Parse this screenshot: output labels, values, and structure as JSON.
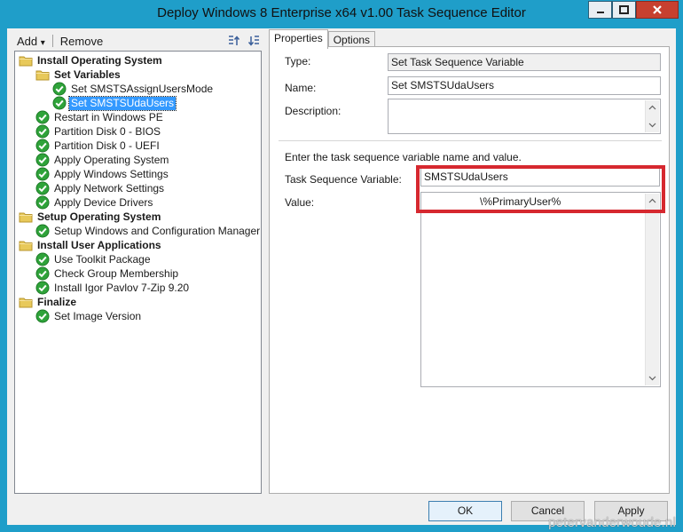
{
  "window": {
    "title": "Deploy Windows 8 Enterprise x64 v1.00 Task Sequence Editor"
  },
  "toolbar": {
    "add_label": "Add",
    "add_arrow": "▾",
    "remove_label": "Remove"
  },
  "tree": {
    "items": [
      {
        "label": "Install Operating System",
        "kind": "group",
        "level": 0
      },
      {
        "label": "Set Variables",
        "kind": "group",
        "level": 1
      },
      {
        "label": "Set SMSTSAssignUsersMode",
        "kind": "step",
        "level": 2
      },
      {
        "label": "Set SMSTSUdaUsers",
        "kind": "step",
        "level": 2,
        "selected": true
      },
      {
        "label": "Restart in Windows PE",
        "kind": "step",
        "level": 1
      },
      {
        "label": "Partition Disk 0 - BIOS",
        "kind": "step",
        "level": 1
      },
      {
        "label": "Partition Disk 0 - UEFI",
        "kind": "step",
        "level": 1
      },
      {
        "label": "Apply Operating System",
        "kind": "step",
        "level": 1
      },
      {
        "label": "Apply Windows Settings",
        "kind": "step",
        "level": 1
      },
      {
        "label": "Apply Network Settings",
        "kind": "step",
        "level": 1
      },
      {
        "label": "Apply Device Drivers",
        "kind": "step",
        "level": 1
      },
      {
        "label": "Setup Operating System",
        "kind": "group",
        "level": 0
      },
      {
        "label": "Setup Windows and Configuration Manager",
        "kind": "step",
        "level": 1
      },
      {
        "label": "Install User Applications",
        "kind": "group",
        "level": 0
      },
      {
        "label": "Use Toolkit Package",
        "kind": "step",
        "level": 1
      },
      {
        "label": "Check Group Membership",
        "kind": "step",
        "level": 1
      },
      {
        "label": "Install Igor Pavlov 7-Zip 9.20",
        "kind": "step",
        "level": 1
      },
      {
        "label": "Finalize",
        "kind": "group",
        "level": 0
      },
      {
        "label": "Set Image Version",
        "kind": "step",
        "level": 1
      }
    ]
  },
  "tabs": {
    "properties": "Properties",
    "options": "Options"
  },
  "properties": {
    "type_label": "Type:",
    "type_value": "Set Task Sequence Variable",
    "name_label": "Name:",
    "name_value": "Set SMSTSUdaUsers",
    "description_label": "Description:",
    "description_value": "",
    "instruction": "Enter the task sequence variable name and value.",
    "variable_label": "Task Sequence Variable:",
    "variable_value": "SMSTSUdaUsers",
    "value_label": "Value:",
    "value_value": "\\%PrimaryUser%"
  },
  "buttons": {
    "ok": "OK",
    "cancel": "Cancel",
    "apply": "Apply"
  },
  "watermark": "petervanderwoude.nl",
  "colors": {
    "frame": "#1f9ec9",
    "selection": "#3399ff",
    "highlight": "#d6282f",
    "check_green": "#2fa33a",
    "folder_yellow": "#e8c95a"
  }
}
